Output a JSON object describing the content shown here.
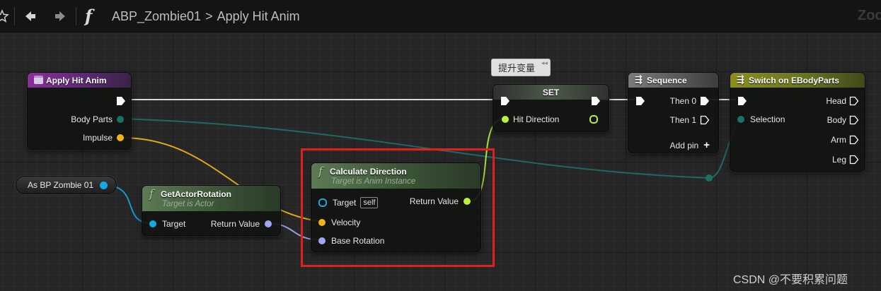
{
  "toolbar": {
    "breadcrumb_blueprint": "ABP_Zombie01",
    "breadcrumb_separator": ">",
    "breadcrumb_function": "Apply Hit Anim",
    "zoom_label": "Zoo"
  },
  "colors": {
    "exec_pin": "#ffffff",
    "struct_pin": "#1f6f68",
    "float_pin": "#f2b315",
    "object_pin": "#15a8e8",
    "rotator_pin": "#a2a6f2",
    "vector_pin": "#b8f23a",
    "highlight": "#e0201f"
  },
  "nodes": {
    "apply_hit_anim": {
      "title": "Apply Hit Anim",
      "pins": {
        "body_parts": "Body Parts",
        "impulse": "Impulse"
      }
    },
    "as_bp_zombie": {
      "label": "As BP Zombie 01"
    },
    "get_actor_rotation": {
      "title": "GetActorRotation",
      "subtitle": "Target is Actor",
      "pins": {
        "target": "Target",
        "return_value": "Return Value"
      }
    },
    "calculate_direction": {
      "title": "Calculate Direction",
      "subtitle": "Target is Anim Instance",
      "pins": {
        "target": "Target",
        "self": "self",
        "return_value": "Return Value",
        "velocity": "Velocity",
        "base_rotation": "Base Rotation"
      }
    },
    "set_node": {
      "title": "SET",
      "pins": {
        "hit_direction": "Hit Direction"
      }
    },
    "sequence": {
      "title": "Sequence",
      "pins": {
        "then0": "Then 0",
        "then1": "Then 1",
        "add_pin": "Add pin"
      }
    },
    "switch_node": {
      "title": "Switch on EBodyParts",
      "pins": {
        "selection": "Selection",
        "head": "Head",
        "body": "Body",
        "arm": "Arm",
        "leg": "Leg"
      }
    }
  },
  "tooltip": {
    "label": "提升变量"
  },
  "watermark": "CSDN @不要积累问题"
}
